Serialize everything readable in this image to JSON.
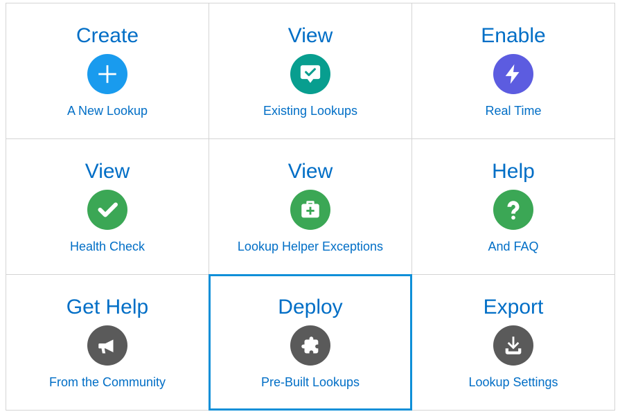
{
  "cards": [
    {
      "title": "Create",
      "subtitle": "A New Lookup",
      "icon": "plus",
      "color": "c-blue",
      "selected": false
    },
    {
      "title": "View",
      "subtitle": "Existing Lookups",
      "icon": "chat",
      "color": "c-teal",
      "selected": false
    },
    {
      "title": "Enable",
      "subtitle": "Real Time",
      "icon": "bolt",
      "color": "c-violet",
      "selected": false
    },
    {
      "title": "View",
      "subtitle": "Health Check",
      "icon": "check",
      "color": "c-green",
      "selected": false
    },
    {
      "title": "View",
      "subtitle": "Lookup Helper Exceptions",
      "icon": "medkit",
      "color": "c-green",
      "selected": false
    },
    {
      "title": "Help",
      "subtitle": "And FAQ",
      "icon": "question",
      "color": "c-green",
      "selected": false
    },
    {
      "title": "Get Help",
      "subtitle": "From the Community",
      "icon": "megaphone",
      "color": "c-gray",
      "selected": false
    },
    {
      "title": "Deploy",
      "subtitle": "Pre-Built Lookups",
      "icon": "puzzle",
      "color": "c-gray",
      "selected": true
    },
    {
      "title": "Export",
      "subtitle": "Lookup Settings",
      "icon": "download",
      "color": "c-gray",
      "selected": false
    }
  ]
}
